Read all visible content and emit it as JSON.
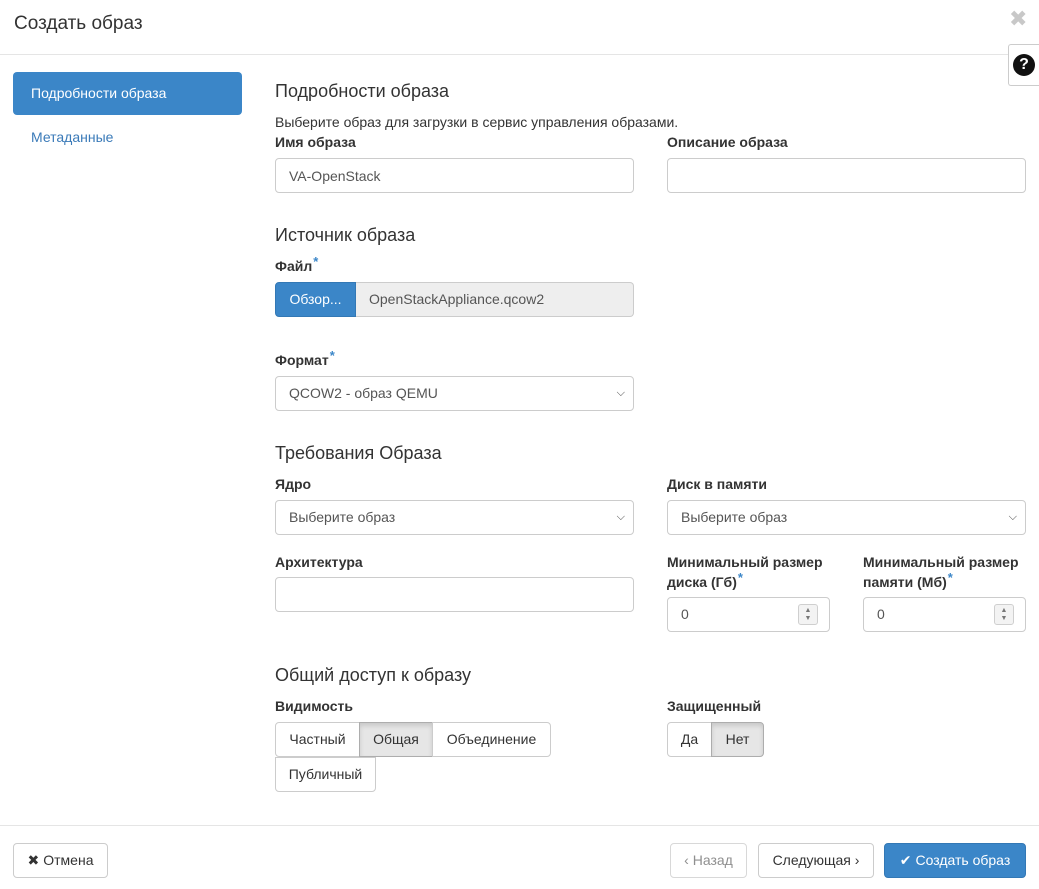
{
  "dialog": {
    "title": "Создать образ"
  },
  "nav": {
    "active_label": "Подробности образа",
    "metadata_label": "Метаданные"
  },
  "details": {
    "heading": "Подробности образа",
    "help": "Выберите образ для загрузки в сервис управления образами.",
    "name_label": "Имя образа",
    "name_value": "VA-OpenStack",
    "description_label": "Описание образа",
    "description_value": ""
  },
  "source": {
    "heading": "Источник образа",
    "file_label": "Файл",
    "browse_label": "Обзор...",
    "file_name": "OpenStackAppliance.qcow2",
    "format_label": "Формат",
    "format_value": "QCOW2 - образ QEMU"
  },
  "requirements": {
    "heading": "Требования Образа",
    "kernel_label": "Ядро",
    "kernel_value": "Выберите образ",
    "ramdisk_label": "Диск в памяти",
    "ramdisk_value": "Выберите образ",
    "arch_label": "Архитектура",
    "arch_value": "",
    "min_disk_label_1": "Минимальный размер",
    "min_disk_label_2": "диска (Гб)",
    "min_disk_value": "0",
    "min_ram_label_1": "Минимальный размер",
    "min_ram_label_2": "памяти (Мб)",
    "min_ram_value": "0"
  },
  "sharing": {
    "heading": "Общий доступ к образу",
    "visibility_label": "Видимость",
    "visibility_options": [
      "Частный",
      "Общая",
      "Объединение",
      "Публичный"
    ],
    "visibility_selected": "Общая",
    "protected_label": "Защищенный",
    "protected_options": [
      "Да",
      "Нет"
    ],
    "protected_selected": "Нет"
  },
  "required_marker": "*",
  "footer": {
    "cancel_label": "Отмена",
    "back_label": "Назад",
    "next_label": "Следующая",
    "create_label": "Создать образ"
  },
  "colors": {
    "accent": "#3b86c8",
    "link": "#3a7ab8",
    "border": "#cccccc"
  },
  "icons": [
    "close-icon",
    "help-icon",
    "chevron-down-icon",
    "spinner-icon",
    "times-icon",
    "chevron-left-icon",
    "chevron-right-icon",
    "check-icon"
  ]
}
